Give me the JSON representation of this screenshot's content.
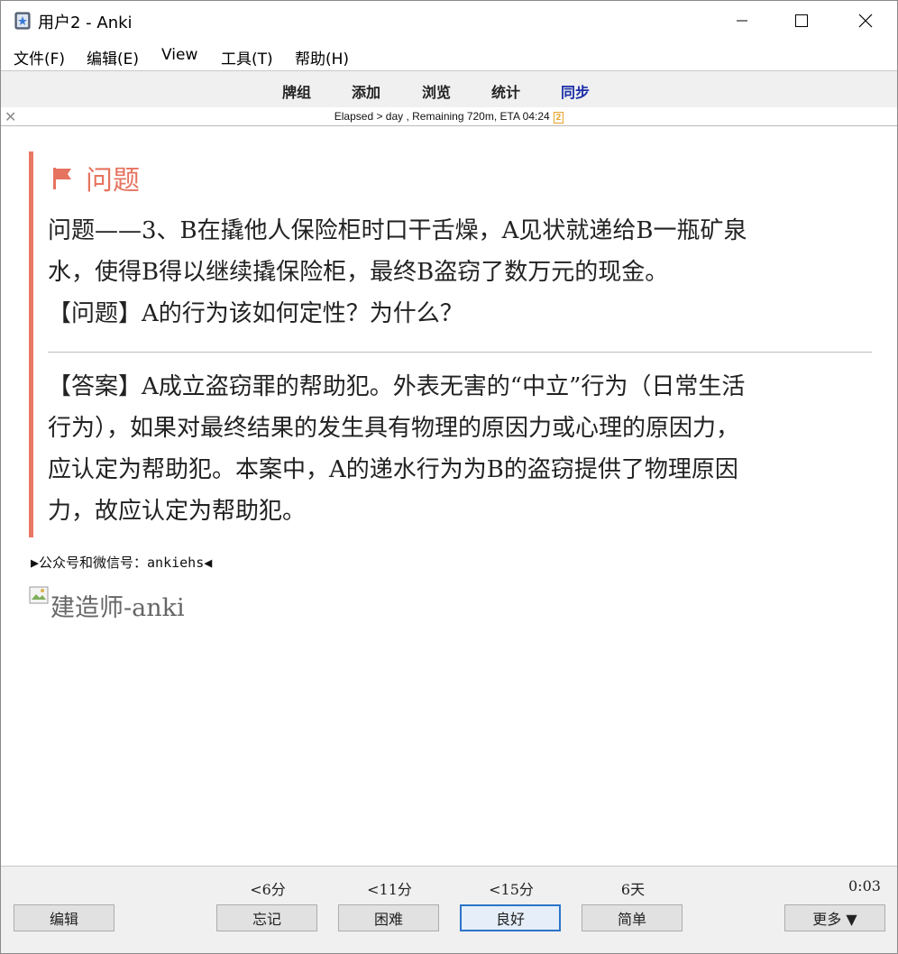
{
  "window": {
    "title": "用户2 - Anki"
  },
  "menu": [
    "文件(F)",
    "编辑(E)",
    "View",
    "工具(T)",
    "帮助(H)"
  ],
  "toolbar": {
    "decks": "牌组",
    "add": "添加",
    "browse": "浏览",
    "stats": "统计",
    "sync": "同步"
  },
  "status": {
    "text": "Elapsed > day , Remaining 720m, ETA 04:24",
    "badge": "2"
  },
  "card": {
    "heading": "问题",
    "question_lines": [
      "问题——3、B在撬他人保险柜时口干舌燥，A见状就递给B一瓶矿泉",
      "水，使得B得以继续撬保险柜，最终B盗窃了数万元的现金。",
      "【问题】A的行为该如何定性？为什么？"
    ],
    "answer_lines": [
      "【答案】A成立盗窃罪的帮助犯。外表无害的“中立”行为（日常生活",
      "行为），如果对最终结果的发生具有物理的原因力或心理的原因力，",
      "应认定为帮助犯。本案中，A的递水行为为B的盗窃提供了物理原因",
      "力，故应认定为帮助犯。"
    ],
    "footer_note": "▶公众号和微信号：ankiehs◀",
    "image_alt": "建造师-anki"
  },
  "review": {
    "intervals": [
      "<6分",
      "<11分",
      "<15分",
      "6天"
    ],
    "edit": "编辑",
    "again": "忘记",
    "hard": "困难",
    "good": "良好",
    "easy": "简单",
    "more": "更多 ▼",
    "timer": "0:03"
  }
}
